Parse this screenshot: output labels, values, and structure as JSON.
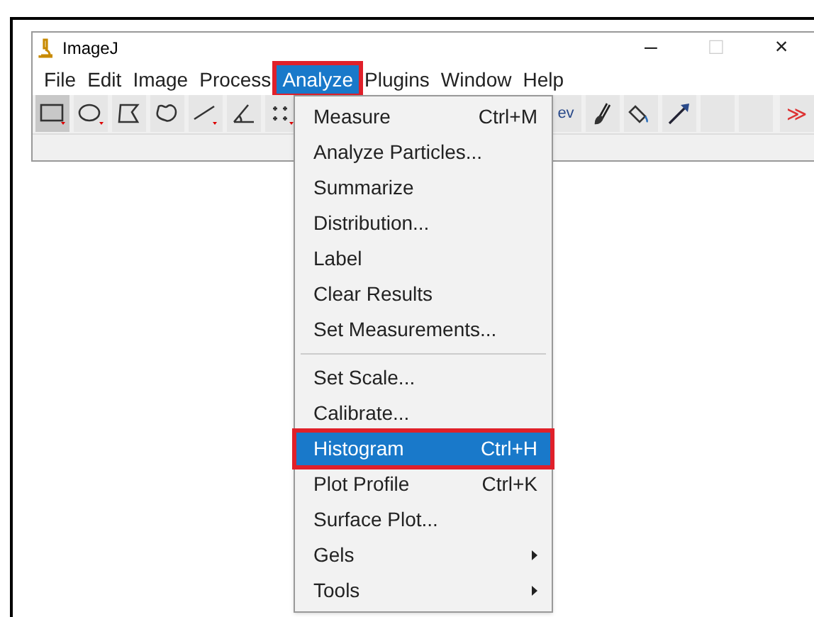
{
  "window": {
    "title": "ImageJ",
    "controls": [
      {
        "label": "–",
        "disabled": false
      },
      {
        "label": "□",
        "disabled": true
      },
      {
        "label": "×",
        "disabled": false
      }
    ]
  },
  "menu_bar": [
    {
      "label": "File",
      "selected": false
    },
    {
      "label": "Edit",
      "selected": false
    },
    {
      "label": "Image",
      "selected": false
    },
    {
      "label": "Process",
      "selected": false
    },
    {
      "label": "Analyze",
      "selected": true
    },
    {
      "label": "Plugins",
      "selected": false
    },
    {
      "label": "Window",
      "selected": false
    },
    {
      "label": "Help",
      "selected": false
    }
  ],
  "toolbar": [
    {
      "kind": "rectangle",
      "selected": true
    },
    {
      "kind": "oval",
      "selected": false
    },
    {
      "kind": "polygon",
      "selected": false
    },
    {
      "kind": "freehand",
      "selected": false
    },
    {
      "kind": "line",
      "selected": false
    },
    {
      "kind": "angle",
      "selected": false
    },
    {
      "kind": "point",
      "selected": false
    },
    {
      "kind": "text",
      "label": "ev",
      "selected": false
    },
    {
      "kind": "brush",
      "selected": false
    },
    {
      "kind": "bucket",
      "selected": false
    },
    {
      "kind": "arrow",
      "selected": false
    },
    {
      "kind": "empty",
      "selected": false
    },
    {
      "kind": "empty",
      "selected": false
    },
    {
      "kind": "more",
      "label": "≫",
      "selected": false
    }
  ],
  "menu": [
    {
      "kind": "item",
      "label": "Measure",
      "shortcut": "Ctrl+M",
      "selected": false
    },
    {
      "kind": "item",
      "label": "Analyze Particles...",
      "selected": false
    },
    {
      "kind": "item",
      "label": "Summarize",
      "selected": false
    },
    {
      "kind": "item",
      "label": "Distribution...",
      "selected": false
    },
    {
      "kind": "item",
      "label": "Label",
      "selected": false
    },
    {
      "kind": "item",
      "label": "Clear Results",
      "selected": false
    },
    {
      "kind": "item",
      "label": "Set Measurements...",
      "selected": false
    },
    {
      "kind": "separator"
    },
    {
      "kind": "item",
      "label": "Set Scale...",
      "selected": false
    },
    {
      "kind": "item",
      "label": "Calibrate...",
      "selected": false
    },
    {
      "kind": "item",
      "label": "Histogram",
      "shortcut": "Ctrl+H",
      "selected": true
    },
    {
      "kind": "item",
      "label": "Plot Profile",
      "shortcut": "Ctrl+K",
      "selected": false
    },
    {
      "kind": "item",
      "label": "Surface Plot...",
      "selected": false
    },
    {
      "kind": "submenu",
      "label": "Gels",
      "selected": false
    },
    {
      "kind": "submenu",
      "label": "Tools",
      "selected": false
    }
  ]
}
